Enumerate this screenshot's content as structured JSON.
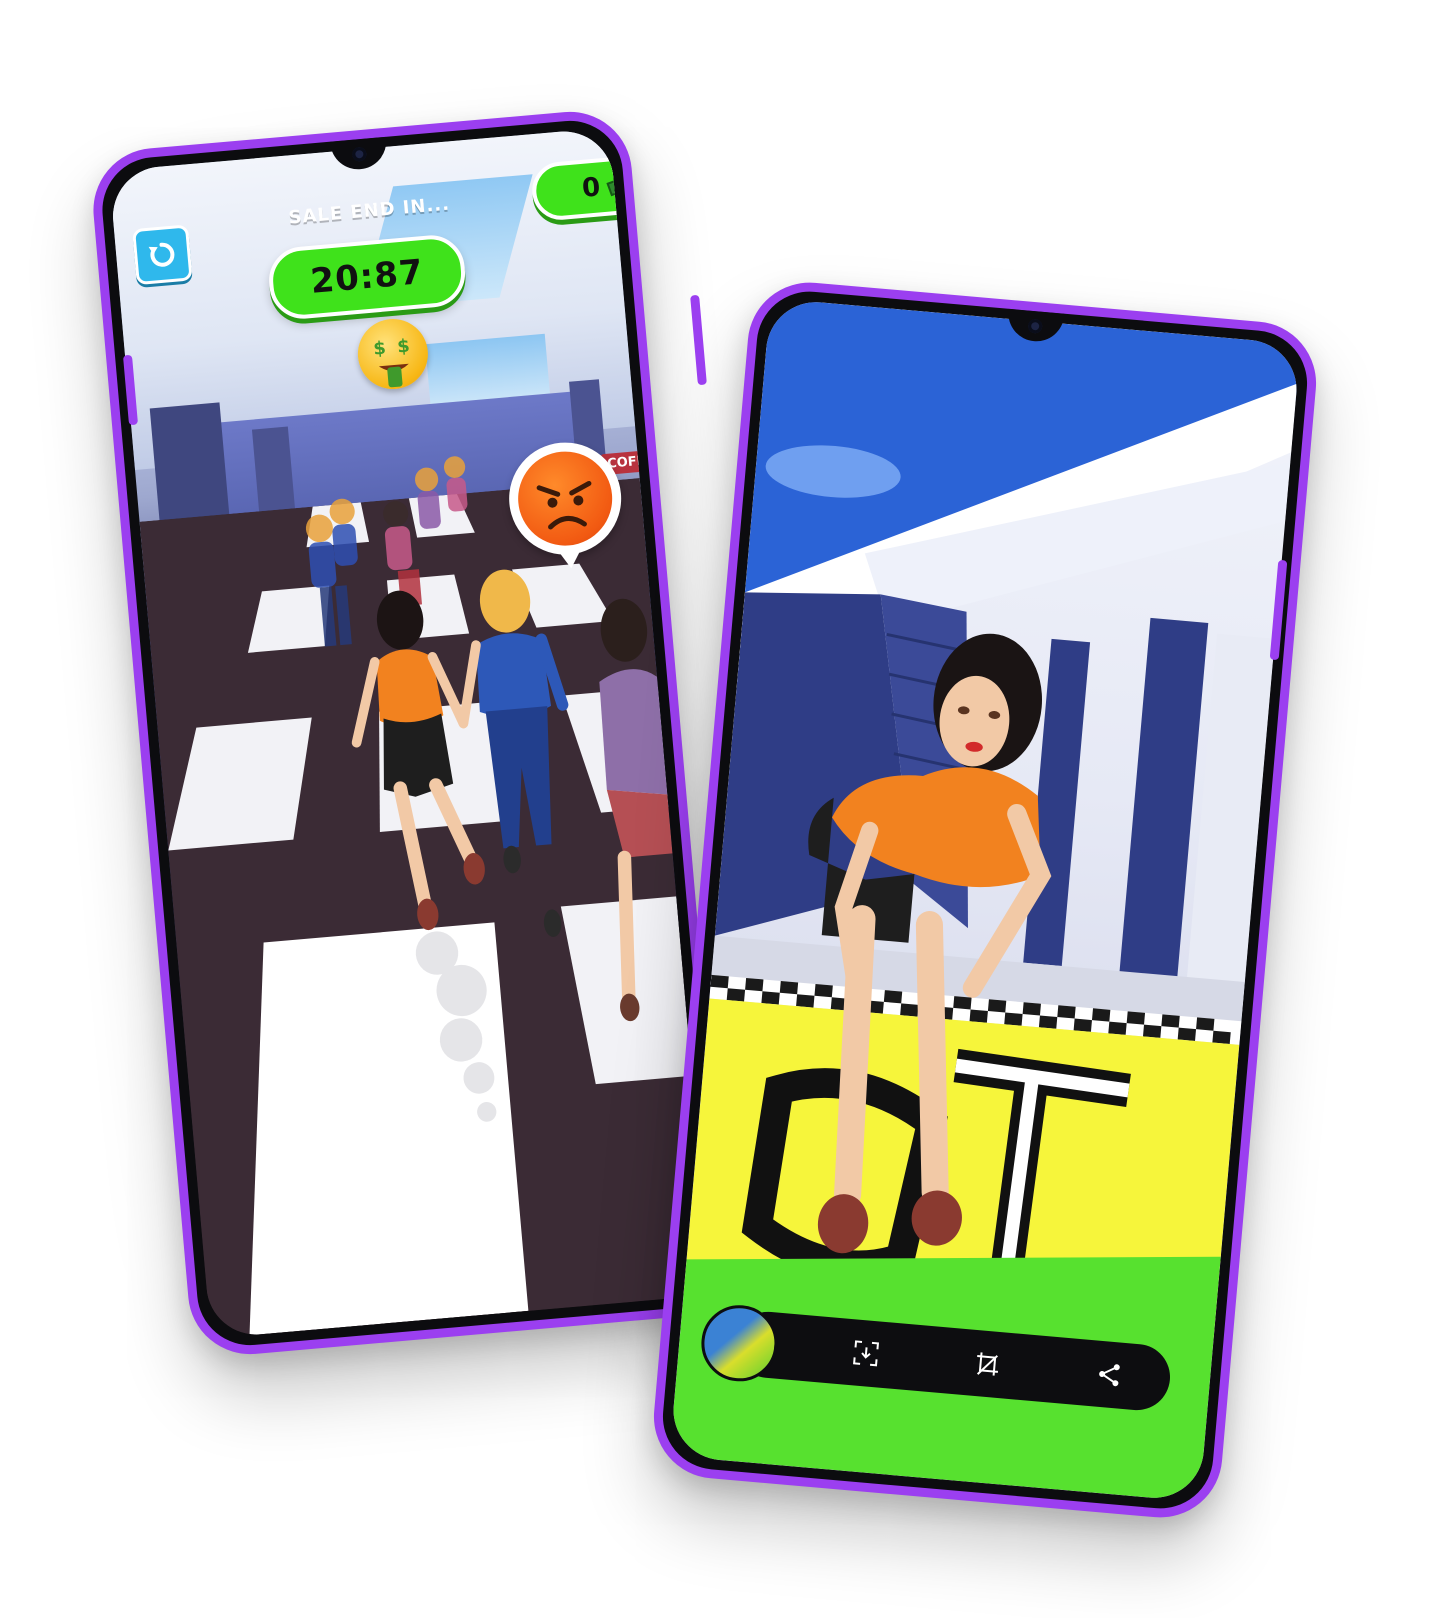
{
  "phone1": {
    "hud": {
      "sale_label": "SALE END IN...",
      "timer": "20:87",
      "coins": "0",
      "restart_icon": "restart-icon",
      "cash_icon": "cash-icon"
    },
    "emotes": {
      "money_face": "money-mouth-face-icon",
      "angry_face": "angry-face-icon"
    },
    "store_sign": "COFFEE"
  },
  "phone2": {
    "toolbar": {
      "thumbnail": "screenshot-thumbnail",
      "icons": [
        "capture-icon",
        "crop-rotate-icon",
        "share-icon"
      ]
    }
  },
  "colors": {
    "phone_frame": "#9b3ff0",
    "timer_green": "#3fe21b",
    "restart_blue": "#2fb8ec",
    "floor_yellow": "#f6f53b",
    "floor_green": "#57e12f",
    "shirt_orange": "#f2821f"
  }
}
